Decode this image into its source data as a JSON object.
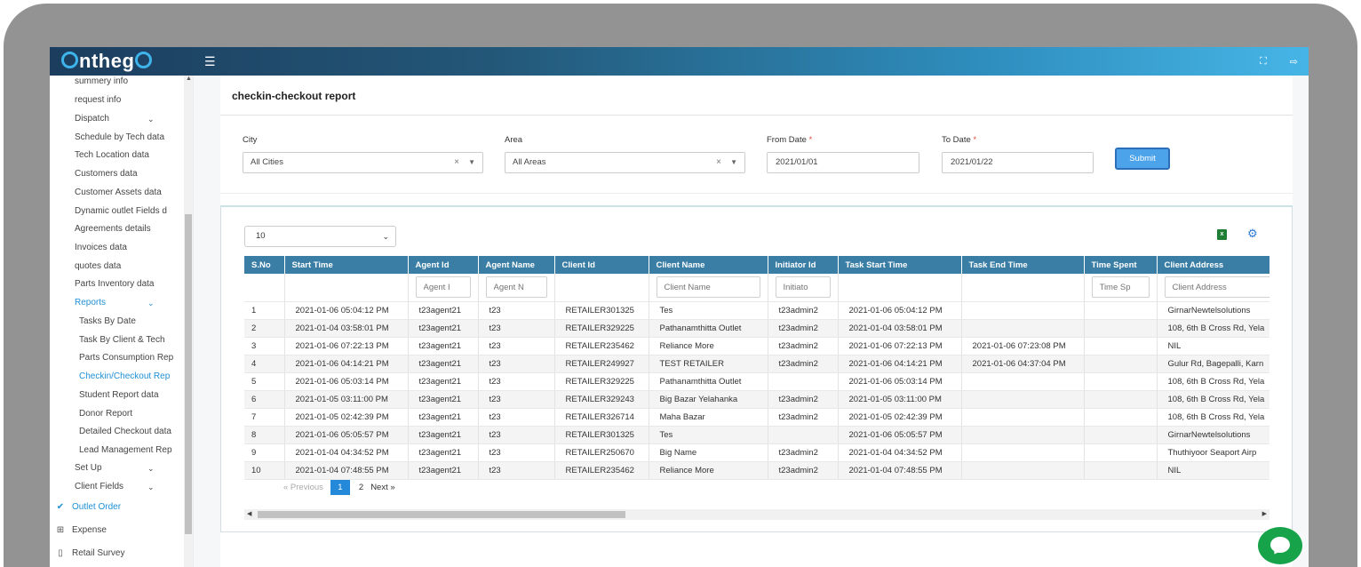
{
  "app": {
    "logo_text": "onthego"
  },
  "sidebar": {
    "items": [
      {
        "label": "summery info"
      },
      {
        "label": "request info"
      },
      {
        "label": "Dispatch"
      },
      {
        "label": "Schedule by Tech data"
      },
      {
        "label": "Tech Location data"
      },
      {
        "label": "Customers data"
      },
      {
        "label": "Customer Assets data"
      },
      {
        "label": "Dynamic outlet Fields d"
      },
      {
        "label": "Agreements details"
      },
      {
        "label": "Invoices data"
      },
      {
        "label": "quotes data"
      },
      {
        "label": "Parts Inventory data"
      },
      {
        "label": "Reports"
      }
    ],
    "report_items": [
      {
        "label": "Tasks By Date"
      },
      {
        "label": "Task By Client & Tech"
      },
      {
        "label": "Parts Consumption Rep"
      },
      {
        "label": "Checkin/Checkout Rep"
      },
      {
        "label": "Student Report data"
      },
      {
        "label": "Donor Report"
      },
      {
        "label": "Detailed Checkout data"
      },
      {
        "label": "Lead Management Rep"
      }
    ],
    "bottom_items": [
      {
        "label": "Set Up"
      },
      {
        "label": "Client Fields"
      }
    ],
    "icon_items": [
      {
        "label": "Outlet Order",
        "icon": "check-icon"
      },
      {
        "label": "Expense",
        "icon": "grid-icon"
      },
      {
        "label": "Retail Survey",
        "icon": "clipboard-icon"
      }
    ]
  },
  "page": {
    "title": "checkin-checkout report"
  },
  "filters": {
    "city_label": "City",
    "city_value": "All Cities",
    "area_label": "Area",
    "area_value": "All Areas",
    "from_label": "From Date",
    "from_value": "2021/01/01",
    "to_label": "To Date",
    "to_value": "2021/01/22",
    "required_mark": "*",
    "submit_label": "Submit"
  },
  "table": {
    "page_size": "10",
    "columns": [
      "S.No",
      "Start Time",
      "Agent Id",
      "Agent Name",
      "Client Id",
      "Client Name",
      "Initiator Id",
      "Task Start Time",
      "Task End Time",
      "Time Spent",
      "Client Address"
    ],
    "filter_placeholders": [
      "",
      "",
      "Agent I",
      "Agent N",
      "",
      "Client Name",
      "Initiato",
      "",
      "",
      "Time Sp",
      "Client Address"
    ],
    "rows": [
      [
        "1",
        "2021-01-06 05:04:12 PM",
        "t23agent21",
        "t23",
        "RETAILER301325",
        "Tes",
        "t23admin2",
        "2021-01-06 05:04:12 PM",
        "",
        "",
        "GirnarNewtelsolutions"
      ],
      [
        "2",
        "2021-01-04 03:58:01 PM",
        "t23agent21",
        "t23",
        "RETAILER329225",
        "Pathanamthitta Outlet",
        "t23admin2",
        "2021-01-04 03:58:01 PM",
        "",
        "",
        "108, 6th B Cross Rd, Yela"
      ],
      [
        "3",
        "2021-01-06 07:22:13 PM",
        "t23agent21",
        "t23",
        "RETAILER235462",
        "Reliance More",
        "t23admin2",
        "2021-01-06 07:22:13 PM",
        "2021-01-06 07:23:08 PM",
        "",
        "NIL"
      ],
      [
        "4",
        "2021-01-06 04:14:21 PM",
        "t23agent21",
        "t23",
        "RETAILER249927",
        "TEST RETAILER",
        "t23admin2",
        "2021-01-06 04:14:21 PM",
        "2021-01-06 04:37:04 PM",
        "",
        "Gulur Rd, Bagepalli, Karn"
      ],
      [
        "5",
        "2021-01-06 05:03:14 PM",
        "t23agent21",
        "t23",
        "RETAILER329225",
        "Pathanamthitta Outlet",
        "",
        "2021-01-06 05:03:14 PM",
        "",
        "",
        "108, 6th B Cross Rd, Yela"
      ],
      [
        "6",
        "2021-01-05 03:11:00 PM",
        "t23agent21",
        "t23",
        "RETAILER329243",
        "Big Bazar Yelahanka",
        "t23admin2",
        "2021-01-05 03:11:00 PM",
        "",
        "",
        "108, 6th B Cross Rd, Yela"
      ],
      [
        "7",
        "2021-01-05 02:42:39 PM",
        "t23agent21",
        "t23",
        "RETAILER326714",
        "Maha Bazar",
        "t23admin2",
        "2021-01-05 02:42:39 PM",
        "",
        "",
        "108, 6th B Cross Rd, Yela"
      ],
      [
        "8",
        "2021-01-06 05:05:57 PM",
        "t23agent21",
        "t23",
        "RETAILER301325",
        "Tes",
        "",
        "2021-01-06 05:05:57 PM",
        "",
        "",
        "GirnarNewtelsolutions"
      ],
      [
        "9",
        "2021-01-04 04:34:52 PM",
        "t23agent21",
        "t23",
        "RETAILER250670",
        "Big Name",
        "t23admin2",
        "2021-01-04 04:34:52 PM",
        "",
        "",
        "Thuthiyoor Seaport Airp"
      ],
      [
        "10",
        "2021-01-04 07:48:55 PM",
        "t23agent21",
        "t23",
        "RETAILER235462",
        "Reliance More",
        "t23admin2",
        "2021-01-04 07:48:55 PM",
        "",
        "",
        "NIL"
      ]
    ]
  },
  "pagination": {
    "previous": "« Previous",
    "current": "1",
    "next_page": "2",
    "next": "Next  »"
  },
  "colors": {
    "header_bg": "#3a7ea5",
    "accent": "#2389d8",
    "submit": "#4da3ea",
    "chat": "#16a34a"
  }
}
